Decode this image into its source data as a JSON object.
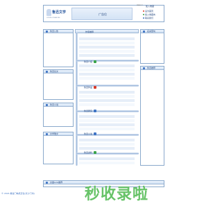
{
  "header": {
    "logo_text": "鲁迅文学",
    "logo_sub": "LUXUN LITERATURE",
    "ad_text": "广告位",
    "top_small": "WAIAO.X",
    "top_link": "加入收藏",
    "links": [
      "设为首页",
      "加入收藏夹",
      "联系我们"
    ]
  },
  "left_panels": [
    {
      "title": "鲁迅公告"
    },
    {
      "title": "鲁迅论文"
    },
    {
      "title": "鲁迅小说"
    },
    {
      "title": "文学散文"
    }
  ],
  "center": {
    "main_title": "作家推荐",
    "categories": [
      {
        "label": "鲁迅介绍",
        "chip_color": "#3aa34a"
      },
      {
        "label": "鲁迅作品",
        "chip_color": "#d83a2a"
      },
      {
        "label": "鲁迅研究",
        "chip_color": "#3f74c4"
      },
      {
        "label": "鲁迅小说",
        "chip_color": "#3f74c4"
      },
      {
        "label": "鲁迅资料",
        "chip_color": "#3aa34a"
      }
    ]
  },
  "right_panels": [
    {
      "title": "名言警句"
    },
    {
      "title": "鲁迅推荐"
    }
  ],
  "bottom_panel": {
    "title": "文章Link推荐"
  },
  "footer": {
    "text": "© 2024 推拉门电机定位(长沙门市)"
  },
  "watermark": "秒收录啦",
  "colors": {
    "accent": "#3f74c4",
    "border": "#8aa9cc",
    "watermark": "#5fc060"
  }
}
